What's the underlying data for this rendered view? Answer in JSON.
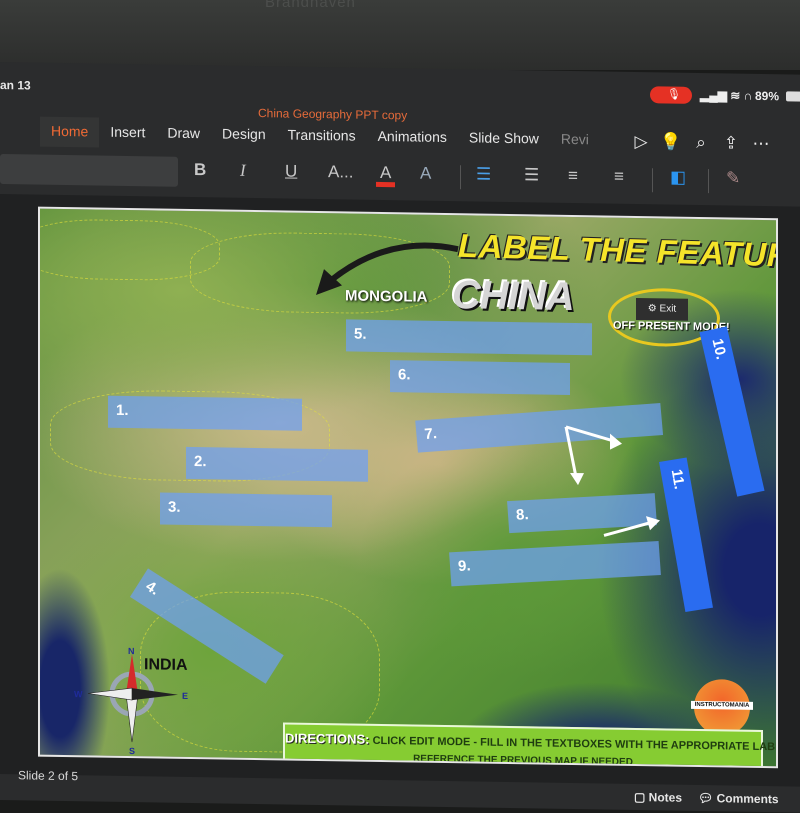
{
  "device": {
    "brand_label": "Brandhaven",
    "time": "an 13",
    "battery": "89%",
    "mic_active_color": "#e53124"
  },
  "app": {
    "document_title": "China Geography PPT copy",
    "tabs": [
      {
        "label": "Home",
        "active": true
      },
      {
        "label": "Insert"
      },
      {
        "label": "Draw"
      },
      {
        "label": "Design"
      },
      {
        "label": "Transitions"
      },
      {
        "label": "Animations"
      },
      {
        "label": "Slide Show"
      },
      {
        "label": "Revi"
      }
    ],
    "tab_icons": [
      "play-icon",
      "lightbulb-icon",
      "search-icon",
      "share-icon",
      "more-icon"
    ],
    "ribbon": {
      "bold": "B",
      "italic": "I",
      "underline": "U",
      "font_size": "A...",
      "font_color": "A",
      "highlight": "A",
      "font_color_value": "#e53124"
    },
    "accent_color": "#f06a35"
  },
  "slide": {
    "title_line1": "LABEL THE FEATURE",
    "title_line2": "CHINA",
    "mongolia": "MONGOLIA",
    "india": "INDIA",
    "exit_label": "Exit",
    "off_present": "OFF PRESENT MODE!",
    "labels": [
      "1.",
      "2.",
      "3.",
      "4.",
      "5.",
      "6.",
      "7.",
      "8.",
      "9.",
      "10.",
      "11."
    ],
    "compass": {
      "n": "N",
      "s": "S",
      "e": "E",
      "w": "W"
    },
    "directions_head": "DIRECTIONS:",
    "directions_text": "CLICK EDIT MODE - FILL IN THE TEXTBOXES WITH THE APPROPRIATE LABELS.",
    "directions_text2": "REFERENCE THE PREVIOUS MAP IF NEEDED",
    "logo_text": "INSTRUCTOMANIA"
  },
  "footer": {
    "slide_count": "Slide 2 of 5",
    "notes": "Notes",
    "comments": "Comments"
  }
}
